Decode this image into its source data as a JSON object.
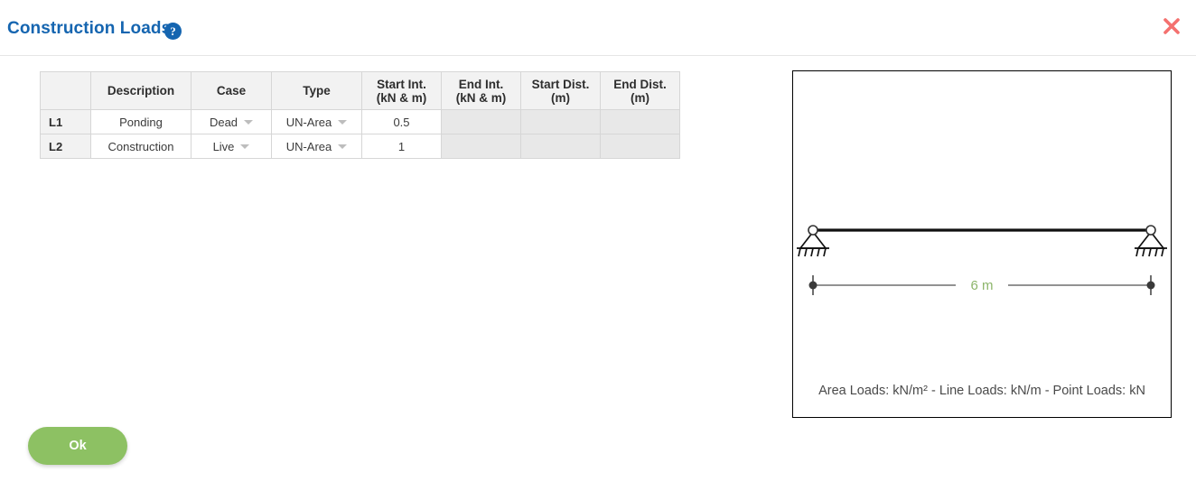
{
  "header": {
    "title": "Construction Loads",
    "help_icon": "help-circle-icon",
    "help_label": "?",
    "close_icon": "close-icon",
    "close_color": "#f4716f",
    "title_color": "#1565b0"
  },
  "table": {
    "columns": [
      {
        "key": "id",
        "line1": "",
        "line2": ""
      },
      {
        "key": "desc",
        "line1": "Description",
        "line2": ""
      },
      {
        "key": "case",
        "line1": "Case",
        "line2": ""
      },
      {
        "key": "type",
        "line1": "Type",
        "line2": ""
      },
      {
        "key": "si",
        "line1": "Start Int.",
        "line2": "(kN & m)"
      },
      {
        "key": "ei",
        "line1": "End Int.",
        "line2": "(kN & m)"
      },
      {
        "key": "sd",
        "line1": "Start Dist.",
        "line2": "(m)"
      },
      {
        "key": "ed",
        "line1": "End Dist.",
        "line2": "(m)"
      }
    ],
    "rows": [
      {
        "id": "L1",
        "description": "Ponding",
        "case": "Dead",
        "type": "UN-Area",
        "start_int": "0.5",
        "end_int": "",
        "start_dist": "",
        "end_dist": ""
      },
      {
        "id": "L2",
        "description": "Construction",
        "case": "Live",
        "type": "UN-Area",
        "start_int": "1",
        "end_int": "",
        "start_dist": "",
        "end_dist": ""
      }
    ]
  },
  "actions": {
    "ok_label": "Ok",
    "ok_color": "#8dc163"
  },
  "diagram": {
    "span_label": "6 m",
    "span_label_color": "#8cb56a",
    "units_note": "Area Loads: kN/m² - Line Loads: kN/m - Point Loads: kN",
    "left_support": "pinned-support-icon",
    "right_support": "pinned-support-icon",
    "beam": "beam-member",
    "dimension_line": "dimension-line"
  }
}
